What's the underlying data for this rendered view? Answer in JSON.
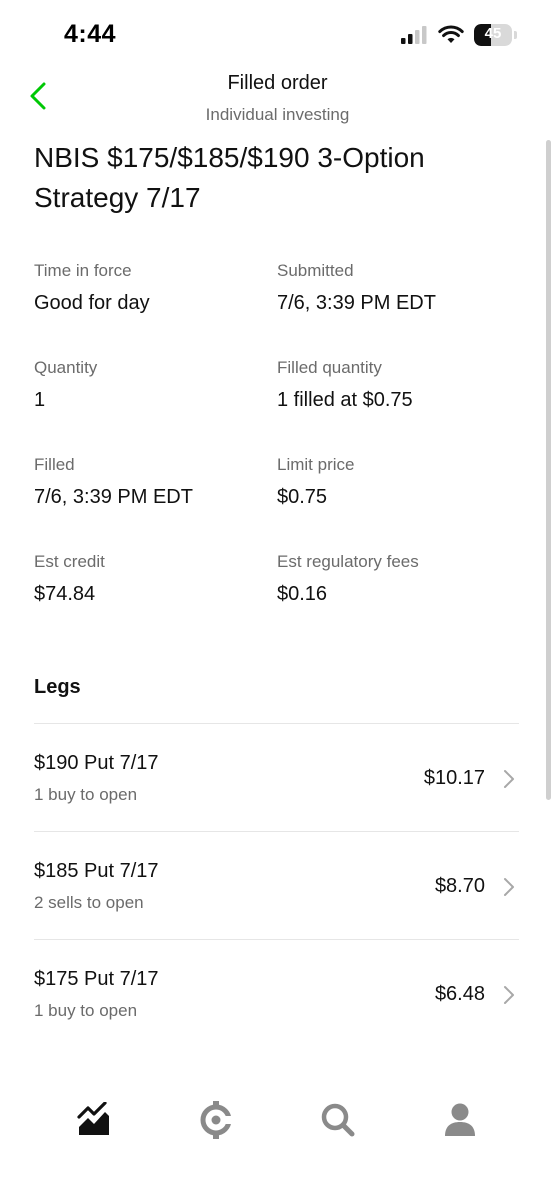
{
  "status_bar": {
    "time": "4:44",
    "battery_percent": 45,
    "battery_text": "45"
  },
  "header": {
    "title": "Filled order",
    "subtitle": "Individual investing",
    "accent_color": "#00c805"
  },
  "order": {
    "title": "NBIS $175/$185/$190 3-Option Strategy 7/17",
    "details": {
      "time_in_force_label": "Time in force",
      "time_in_force_value": "Good for day",
      "submitted_label": "Submitted",
      "submitted_value": "7/6, 3:39 PM EDT",
      "quantity_label": "Quantity",
      "quantity_value": "1",
      "filled_quantity_label": "Filled quantity",
      "filled_quantity_value": "1 filled at $0.75",
      "filled_label": "Filled",
      "filled_value": "7/6, 3:39 PM EDT",
      "limit_price_label": "Limit price",
      "limit_price_value": "$0.75",
      "est_credit_label": "Est credit",
      "est_credit_value": "$74.84",
      "est_fees_label": "Est regulatory fees",
      "est_fees_value": "$0.16"
    }
  },
  "legs": {
    "heading": "Legs",
    "items": [
      {
        "name": "$190 Put 7/17",
        "action": "1 buy to open",
        "price": "$10.17"
      },
      {
        "name": "$185 Put 7/17",
        "action": "2 sells to open",
        "price": "$8.70"
      },
      {
        "name": "$175 Put 7/17",
        "action": "1 buy to open",
        "price": "$6.48"
      }
    ]
  },
  "bottom_nav": {
    "items": [
      {
        "icon": "chart-icon",
        "active": true
      },
      {
        "icon": "crypto-icon",
        "active": false
      },
      {
        "icon": "search-icon",
        "active": false
      },
      {
        "icon": "account-icon",
        "active": false
      }
    ],
    "active_color": "#111111",
    "inactive_color": "#8a8a8a"
  }
}
